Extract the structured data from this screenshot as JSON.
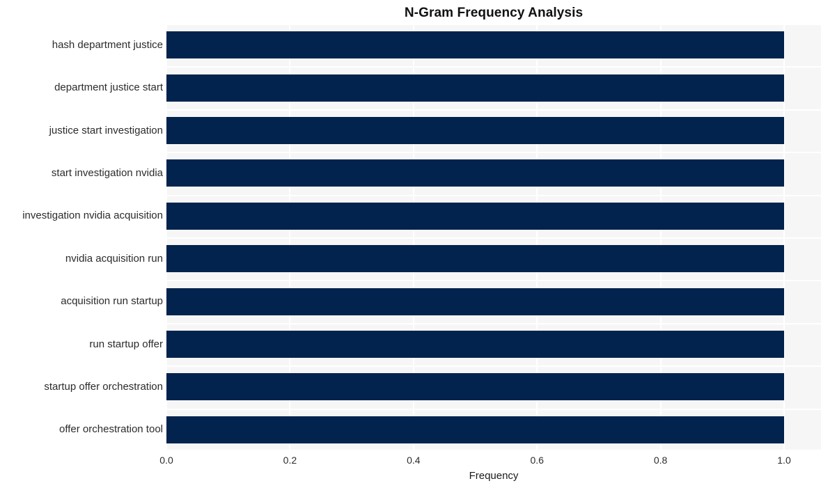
{
  "chart_data": {
    "type": "bar",
    "orientation": "horizontal",
    "title": "N-Gram Frequency Analysis",
    "xlabel": "Frequency",
    "ylabel": "",
    "xlim": [
      0.0,
      1.0589
    ],
    "grid": true,
    "legend": false,
    "bar_color": "#02234d",
    "plot_background": "#f6f6f6",
    "gridline_color": "#ffffff",
    "categories": [
      "hash department justice",
      "department justice start",
      "justice start investigation",
      "start investigation nvidia",
      "investigation nvidia acquisition",
      "nvidia acquisition run",
      "acquisition run startup",
      "run startup offer",
      "startup offer orchestration",
      "offer orchestration tool"
    ],
    "values": [
      1.0,
      1.0,
      1.0,
      1.0,
      1.0,
      1.0,
      1.0,
      1.0,
      1.0,
      1.0
    ],
    "xticks": [
      "0.0",
      "0.2",
      "0.4",
      "0.6",
      "0.8",
      "1.0"
    ],
    "xtick_values": [
      0.0,
      0.2,
      0.4,
      0.6,
      0.8,
      1.0
    ]
  }
}
